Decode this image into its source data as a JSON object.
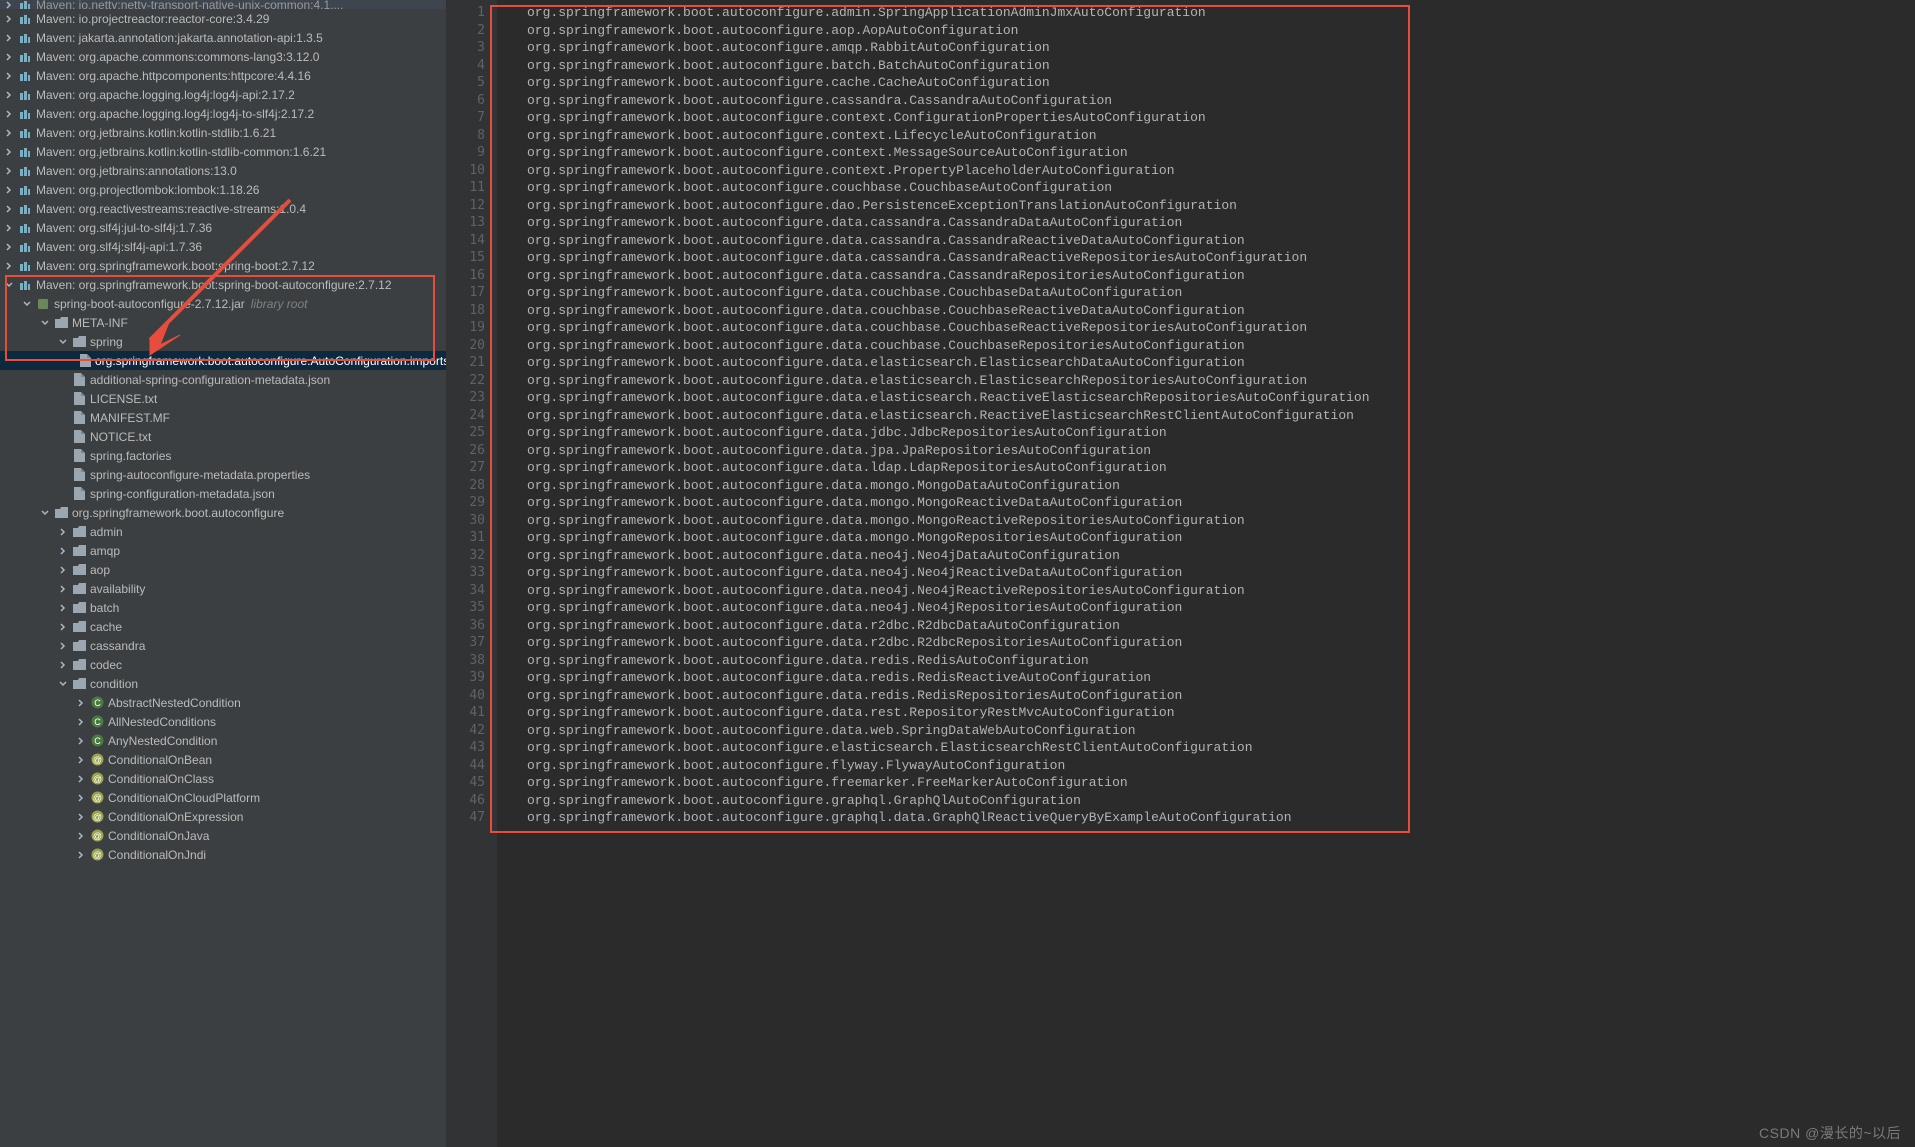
{
  "watermark": "CSDN @漫长的~以后",
  "tree": {
    "topCut": "Maven: io.netty:netty-transport-native-unix-common:4.1....",
    "mavenItems": [
      "Maven: io.projectreactor:reactor-core:3.4.29",
      "Maven: jakarta.annotation:jakarta.annotation-api:1.3.5",
      "Maven: org.apache.commons:commons-lang3:3.12.0",
      "Maven: org.apache.httpcomponents:httpcore:4.4.16",
      "Maven: org.apache.logging.log4j:log4j-api:2.17.2",
      "Maven: org.apache.logging.log4j:log4j-to-slf4j:2.17.2",
      "Maven: org.jetbrains.kotlin:kotlin-stdlib:1.6.21",
      "Maven: org.jetbrains.kotlin:kotlin-stdlib-common:1.6.21",
      "Maven: org.jetbrains:annotations:13.0",
      "Maven: org.projectlombok:lombok:1.18.26",
      "Maven: org.reactivestreams:reactive-streams:1.0.4",
      "Maven: org.slf4j:jul-to-slf4j:1.7.36",
      "Maven: org.slf4j:slf4j-api:1.7.36",
      "Maven: org.springframework.boot:spring-boot:2.7.12"
    ],
    "openedMaven": "Maven: org.springframework.boot:spring-boot-autoconfigure:2.7.12",
    "jar": {
      "name": "spring-boot-autoconfigure-2.7.12.jar",
      "hint": "library root"
    },
    "metaInf": "META-INF",
    "springFolder": "spring",
    "selectedFile": "org.springframework.boot.autoconfigure.AutoConfiguration.imports",
    "metaFiles": [
      "additional-spring-configuration-metadata.json",
      "LICENSE.txt",
      "MANIFEST.MF",
      "NOTICE.txt",
      "spring.factories",
      "spring-autoconfigure-metadata.properties",
      "spring-configuration-metadata.json"
    ],
    "packageRoot": "org.springframework.boot.autoconfigure",
    "packages": [
      {
        "name": "admin",
        "open": false
      },
      {
        "name": "amqp",
        "open": false
      },
      {
        "name": "aop",
        "open": false
      },
      {
        "name": "availability",
        "open": false
      },
      {
        "name": "batch",
        "open": false
      },
      {
        "name": "cache",
        "open": false
      },
      {
        "name": "cassandra",
        "open": false
      },
      {
        "name": "codec",
        "open": false
      }
    ],
    "conditionPkg": "condition",
    "conditionClasses": [
      "AbstractNestedCondition",
      "AllNestedConditions",
      "AnyNestedCondition",
      "ConditionalOnBean",
      "ConditionalOnClass",
      "ConditionalOnCloudPlatform",
      "ConditionalOnExpression",
      "ConditionalOnJava",
      "ConditionalOnJndi"
    ]
  },
  "code": {
    "lines": [
      "org.springframework.boot.autoconfigure.admin.SpringApplicationAdminJmxAutoConfiguration",
      "org.springframework.boot.autoconfigure.aop.AopAutoConfiguration",
      "org.springframework.boot.autoconfigure.amqp.RabbitAutoConfiguration",
      "org.springframework.boot.autoconfigure.batch.BatchAutoConfiguration",
      "org.springframework.boot.autoconfigure.cache.CacheAutoConfiguration",
      "org.springframework.boot.autoconfigure.cassandra.CassandraAutoConfiguration",
      "org.springframework.boot.autoconfigure.context.ConfigurationPropertiesAutoConfiguration",
      "org.springframework.boot.autoconfigure.context.LifecycleAutoConfiguration",
      "org.springframework.boot.autoconfigure.context.MessageSourceAutoConfiguration",
      "org.springframework.boot.autoconfigure.context.PropertyPlaceholderAutoConfiguration",
      "org.springframework.boot.autoconfigure.couchbase.CouchbaseAutoConfiguration",
      "org.springframework.boot.autoconfigure.dao.PersistenceExceptionTranslationAutoConfiguration",
      "org.springframework.boot.autoconfigure.data.cassandra.CassandraDataAutoConfiguration",
      "org.springframework.boot.autoconfigure.data.cassandra.CassandraReactiveDataAutoConfiguration",
      "org.springframework.boot.autoconfigure.data.cassandra.CassandraReactiveRepositoriesAutoConfiguration",
      "org.springframework.boot.autoconfigure.data.cassandra.CassandraRepositoriesAutoConfiguration",
      "org.springframework.boot.autoconfigure.data.couchbase.CouchbaseDataAutoConfiguration",
      "org.springframework.boot.autoconfigure.data.couchbase.CouchbaseReactiveDataAutoConfiguration",
      "org.springframework.boot.autoconfigure.data.couchbase.CouchbaseReactiveRepositoriesAutoConfiguration",
      "org.springframework.boot.autoconfigure.data.couchbase.CouchbaseRepositoriesAutoConfiguration",
      "org.springframework.boot.autoconfigure.data.elasticsearch.ElasticsearchDataAutoConfiguration",
      "org.springframework.boot.autoconfigure.data.elasticsearch.ElasticsearchRepositoriesAutoConfiguration",
      "org.springframework.boot.autoconfigure.data.elasticsearch.ReactiveElasticsearchRepositoriesAutoConfiguration",
      "org.springframework.boot.autoconfigure.data.elasticsearch.ReactiveElasticsearchRestClientAutoConfiguration",
      "org.springframework.boot.autoconfigure.data.jdbc.JdbcRepositoriesAutoConfiguration",
      "org.springframework.boot.autoconfigure.data.jpa.JpaRepositoriesAutoConfiguration",
      "org.springframework.boot.autoconfigure.data.ldap.LdapRepositoriesAutoConfiguration",
      "org.springframework.boot.autoconfigure.data.mongo.MongoDataAutoConfiguration",
      "org.springframework.boot.autoconfigure.data.mongo.MongoReactiveDataAutoConfiguration",
      "org.springframework.boot.autoconfigure.data.mongo.MongoReactiveRepositoriesAutoConfiguration",
      "org.springframework.boot.autoconfigure.data.mongo.MongoRepositoriesAutoConfiguration",
      "org.springframework.boot.autoconfigure.data.neo4j.Neo4jDataAutoConfiguration",
      "org.springframework.boot.autoconfigure.data.neo4j.Neo4jReactiveDataAutoConfiguration",
      "org.springframework.boot.autoconfigure.data.neo4j.Neo4jReactiveRepositoriesAutoConfiguration",
      "org.springframework.boot.autoconfigure.data.neo4j.Neo4jRepositoriesAutoConfiguration",
      "org.springframework.boot.autoconfigure.data.r2dbc.R2dbcDataAutoConfiguration",
      "org.springframework.boot.autoconfigure.data.r2dbc.R2dbcRepositoriesAutoConfiguration",
      "org.springframework.boot.autoconfigure.data.redis.RedisAutoConfiguration",
      "org.springframework.boot.autoconfigure.data.redis.RedisReactiveAutoConfiguration",
      "org.springframework.boot.autoconfigure.data.redis.RedisRepositoriesAutoConfiguration",
      "org.springframework.boot.autoconfigure.data.rest.RepositoryRestMvcAutoConfiguration",
      "org.springframework.boot.autoconfigure.data.web.SpringDataWebAutoConfiguration",
      "org.springframework.boot.autoconfigure.elasticsearch.ElasticsearchRestClientAutoConfiguration",
      "org.springframework.boot.autoconfigure.flyway.FlywayAutoConfiguration",
      "org.springframework.boot.autoconfigure.freemarker.FreeMarkerAutoConfiguration",
      "org.springframework.boot.autoconfigure.graphql.GraphQlAutoConfiguration",
      "org.springframework.boot.autoconfigure.graphql.data.GraphQlReactiveQueryByExampleAutoConfiguration"
    ]
  }
}
